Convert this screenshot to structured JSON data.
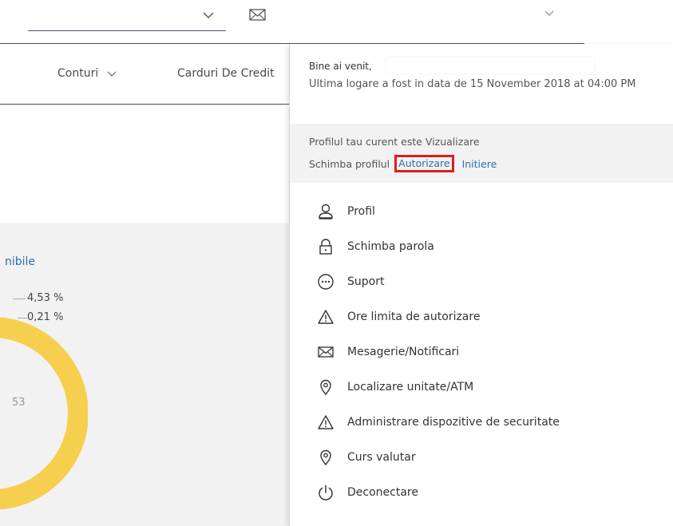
{
  "nav": {
    "conturi": "Conturi",
    "carduri": "Carduri De Credit"
  },
  "chart_area": {
    "title_fragment": "nibile",
    "percent_1": "4,53 %",
    "percent_2": "0,21 %",
    "center_fragment": "53"
  },
  "colors": {
    "accent_link": "#2e6fa8",
    "donut": "#f7cf4f",
    "highlight_box": "#e01d1d",
    "nav_line": "#3d4d6a"
  },
  "panel": {
    "welcome": "Bine ai venit,",
    "last_login": "Ultima logare a fost in data de 15 November 2018 at 04:00 PM",
    "profile_current": "Profilul tau curent este  Vizualizare",
    "profile_change_label": "Schimba profilul",
    "profile_options": [
      "Autorizare",
      "Initiere"
    ],
    "menu": [
      {
        "label": "Profil",
        "icon": "user-icon"
      },
      {
        "label": "Schimba parola",
        "icon": "lock-icon"
      },
      {
        "label": "Suport",
        "icon": "ellipsis-circle-icon"
      },
      {
        "label": "Ore limita de autorizare",
        "icon": "warning-icon"
      },
      {
        "label": "Mesagerie/Notificari",
        "icon": "mail-icon"
      },
      {
        "label": "Localizare unitate/ATM",
        "icon": "location-pin-icon"
      },
      {
        "label": "Administrare dispozitive de securitate",
        "icon": "warning-icon"
      },
      {
        "label": "Curs valutar",
        "icon": "location-pin-icon"
      },
      {
        "label": "Deconectare",
        "icon": "power-icon"
      }
    ]
  }
}
